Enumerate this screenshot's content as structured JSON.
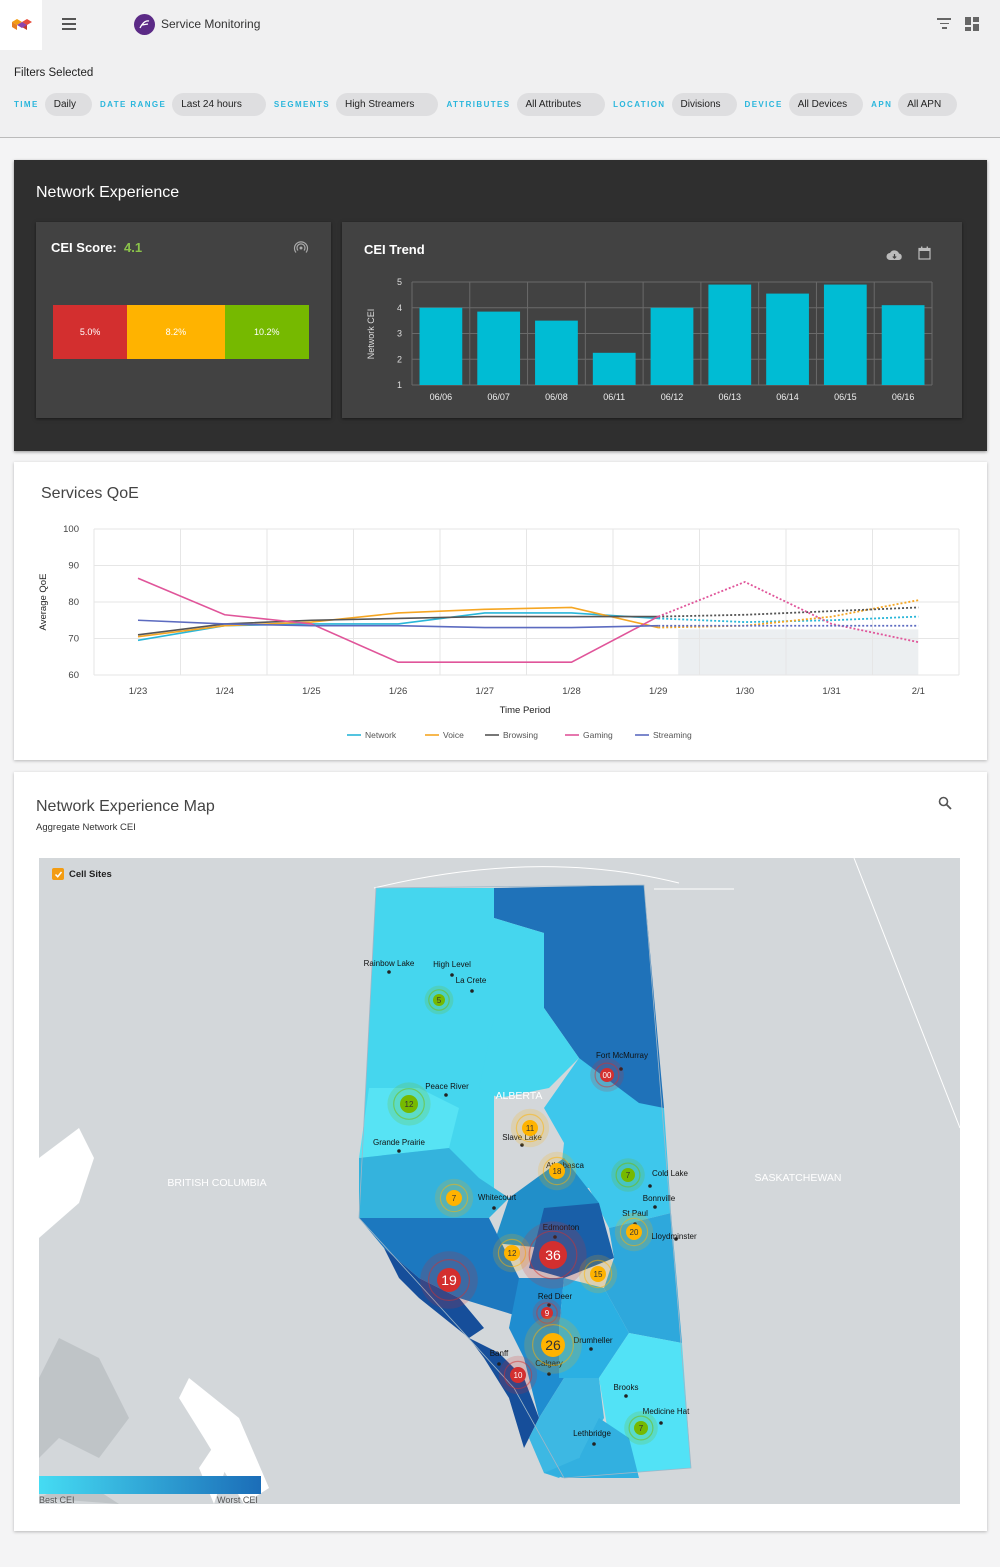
{
  "app": {
    "title": "Service Monitoring"
  },
  "filters": {
    "title": "Filters Selected",
    "items": [
      {
        "label": "TIME",
        "value": "Daily"
      },
      {
        "label": "DATE RANGE",
        "value": "Last 24 hours"
      },
      {
        "label": "SEGMENTS",
        "value": "High Streamers"
      },
      {
        "label": "ATTRIBUTES",
        "value": "All Attributes"
      },
      {
        "label": "LOCATION",
        "value": "Divisions"
      },
      {
        "label": "DEVICE",
        "value": "All Devices"
      },
      {
        "label": "APN",
        "value": "All APN"
      }
    ]
  },
  "network_experience": {
    "title": "Network Experience",
    "cei": {
      "label": "CEI Score:",
      "value": "4.1",
      "segments": [
        {
          "text": "5.0%",
          "fraction": 0.29,
          "color": "#d32f2f"
        },
        {
          "text": "8.2%",
          "fraction": 0.38,
          "color": "#ffb300"
        },
        {
          "text": "10.2%",
          "fraction": 0.33,
          "color": "#76b900"
        }
      ]
    },
    "trend": {
      "title": "CEI Trend"
    }
  },
  "services_qoe": {
    "title": "Services QoE"
  },
  "map": {
    "title": "Network Experience Map",
    "subtitle": "Aggregate Network CEI",
    "cell_sites_label": "Cell Sites",
    "legend_best": "Best CEI",
    "legend_worst": "Worst CEI",
    "regions": {
      "bc": "BRITISH COLUMBIA",
      "ab": "ALBERTA",
      "sk": "SASKATCHEWAN"
    },
    "cities": [
      "Rainbow Lake",
      "High Level",
      "La Crete",
      "Fort McMurray",
      "Peace River",
      "Slave Lake",
      "Grande Prairie",
      "Athabasca",
      "Cold Lake",
      "Bonnville",
      "Whitecourt",
      "St Paul",
      "Edmonton",
      "Lloydminster",
      "Red Deer",
      "Drumheller",
      "Banff",
      "Calgary",
      "Brooks",
      "Medicine Hat",
      "Lethbridge"
    ],
    "clusters": [
      "5",
      "00",
      "12",
      "11",
      "18",
      "7",
      "7",
      "20",
      "12",
      "36",
      "15",
      "19",
      "9",
      "26",
      "10",
      "7"
    ]
  },
  "chart_data": [
    {
      "type": "bar",
      "title": "CEI Trend",
      "ylabel": "Network CEI",
      "ylim": [
        1,
        5
      ],
      "yticks": [
        "1",
        "2",
        "3",
        "4",
        "5"
      ],
      "categories": [
        "06/06",
        "06/07",
        "06/08",
        "06/11",
        "06/12",
        "06/13",
        "06/14",
        "06/15",
        "06/16"
      ],
      "values": [
        4.0,
        3.85,
        3.5,
        2.25,
        4.0,
        4.9,
        4.55,
        4.9,
        4.1
      ],
      "color": "#00bcd4"
    },
    {
      "type": "line",
      "title": "Services QoE",
      "xlabel": "Time Period",
      "ylabel": "Average QoE",
      "ylim": [
        60,
        100
      ],
      "yticks": [
        "60",
        "70",
        "80",
        "90",
        "100"
      ],
      "categories": [
        "1/23",
        "1/24",
        "1/25",
        "1/26",
        "1/27",
        "1/28",
        "1/29",
        "1/30",
        "1/31",
        "2/1"
      ],
      "forecast_from": "1/29",
      "series": [
        {
          "name": "Network",
          "color": "#29b6d8",
          "values": [
            69.5,
            73.5,
            74.0,
            74.0,
            77.0,
            77.0,
            75.5,
            74.5,
            75.0,
            76.0
          ]
        },
        {
          "name": "Voice",
          "color": "#f5a623",
          "values": [
            70.5,
            73.5,
            74.5,
            77.0,
            78.0,
            78.5,
            73.0,
            73.5,
            76.0,
            80.5
          ]
        },
        {
          "name": "Browsing",
          "color": "#555555",
          "values": [
            71.0,
            74.0,
            75.0,
            75.5,
            76.0,
            76.0,
            76.0,
            76.5,
            77.5,
            78.5
          ]
        },
        {
          "name": "Gaming",
          "color": "#e0559a",
          "values": [
            86.5,
            76.5,
            74.0,
            63.5,
            63.5,
            63.5,
            76.0,
            85.5,
            74.0,
            69.0
          ]
        },
        {
          "name": "Streaming",
          "color": "#5c6bc0",
          "values": [
            75.0,
            74.0,
            73.5,
            73.5,
            73.0,
            73.0,
            73.5,
            73.5,
            73.5,
            73.5
          ]
        }
      ]
    }
  ]
}
